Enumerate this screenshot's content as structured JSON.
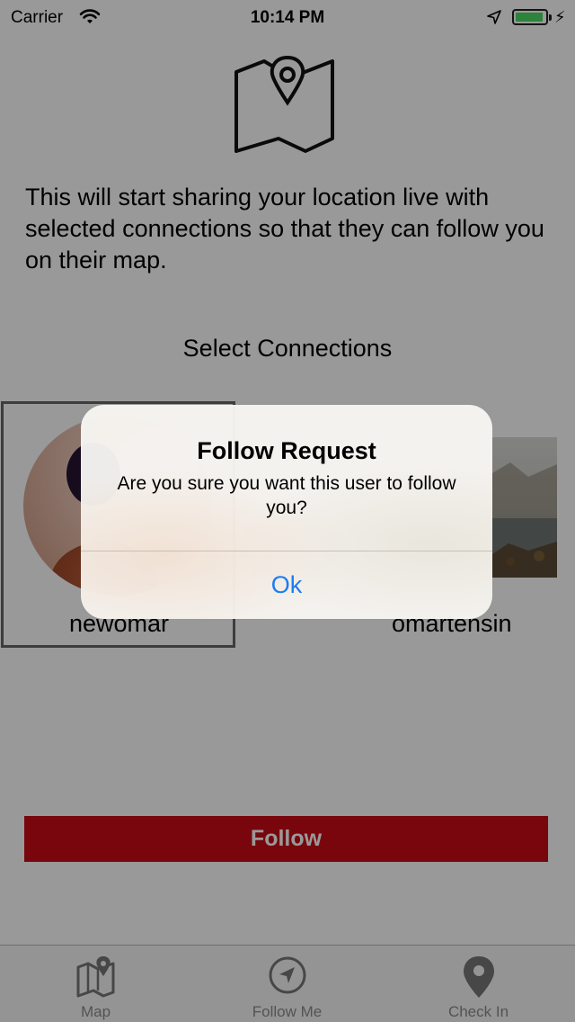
{
  "status_bar": {
    "carrier": "Carrier",
    "time": "10:14 PM",
    "battery_color": "#4cd964"
  },
  "main": {
    "header_icon": "map-pin-icon",
    "intro_text": "This will start sharing your location live with selected connections so that they can follow you on their map.",
    "section_title": "Select Connections",
    "connections": [
      {
        "name": "newomar",
        "selected": true
      },
      {
        "name": "omartensin",
        "selected": false
      }
    ],
    "follow_button": "Follow",
    "follow_button_color": "#c80a14"
  },
  "alert": {
    "title": "Follow Request",
    "message": "Are you sure you want this user to follow you?",
    "ok_button": "Ok",
    "ok_color": "#1a7cf5"
  },
  "tab_bar": {
    "items": [
      {
        "label": "Map",
        "icon": "map-icon"
      },
      {
        "label": "Follow Me",
        "icon": "navigation-arrow-icon"
      },
      {
        "label": "Check In",
        "icon": "location-pin-icon"
      }
    ]
  }
}
